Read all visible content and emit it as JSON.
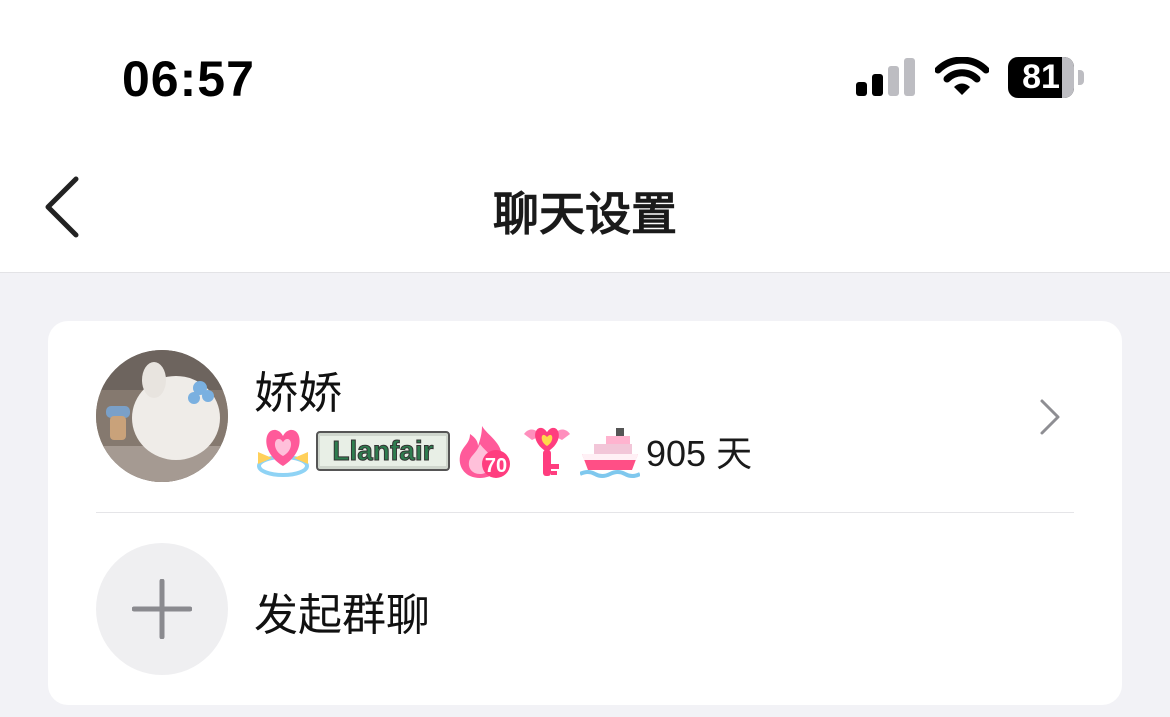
{
  "status_bar": {
    "time": "06:57",
    "battery": "81",
    "signal_icon": "signal-bars-icon",
    "wifi_icon": "wifi-icon"
  },
  "header": {
    "title": "聊天设置",
    "back_icon": "chevron-left-icon"
  },
  "contact": {
    "name": "娇娇",
    "badges": [
      "heart-bow-badge",
      "llanfair-badge",
      "flame-70-badge",
      "heart-key-badge",
      "ship-badge"
    ],
    "flame_level": "70",
    "days": "905 天"
  },
  "actions": {
    "start_group": "发起群聊"
  },
  "colors": {
    "page_bg": "#f2f2f6",
    "card_bg": "#ffffff",
    "pink": "#ff5a9a",
    "text": "#111111"
  }
}
